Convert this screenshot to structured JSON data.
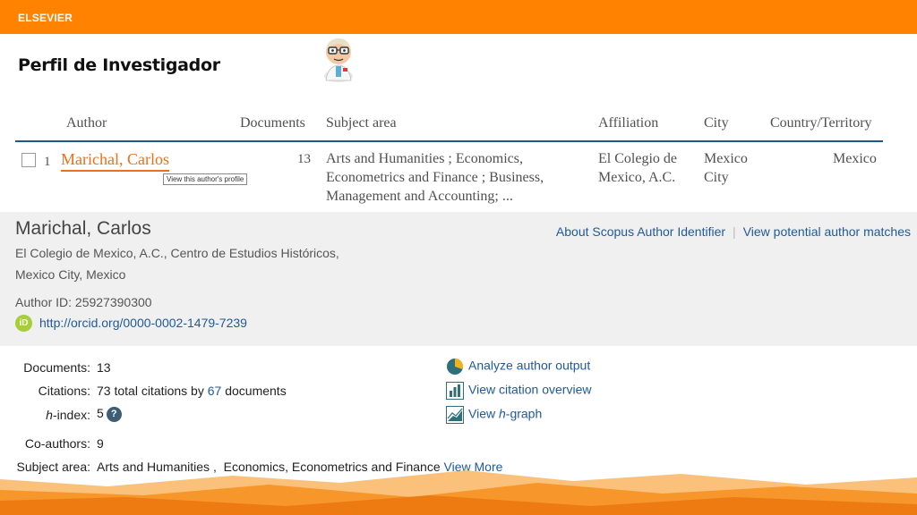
{
  "header": {
    "brand": "ELSEVIER",
    "accent": "#ff8200"
  },
  "page": {
    "title": "Perfil de Investigador",
    "mascot_icon": "scientist-cartoon-icon"
  },
  "results_table": {
    "columns": [
      "Author",
      "Documents",
      "Subject area",
      "Affiliation",
      "City",
      "Country/Territory"
    ],
    "rows": [
      {
        "index": "1",
        "author": "Marichal, Carlos",
        "tooltip": "View this author's profile",
        "documents": "13",
        "subject_lines": [
          "Arts and Humanities ; Economics,",
          "Econometrics and Finance ; Business,",
          "Management and Accounting; ..."
        ],
        "affiliation_lines": [
          "El Colegio de",
          "Mexico, A.C."
        ],
        "city_lines": [
          "Mexico",
          "City"
        ],
        "country": "Mexico"
      }
    ]
  },
  "author_details": {
    "name": "Marichal, Carlos",
    "affiliation_line1": "El Colegio de Mexico, A.C., Centro de Estudios Históricos,",
    "affiliation_line2": "Mexico City, Mexico",
    "author_id": "Author ID: 25927390300",
    "orcid_url": "http://orcid.org/0000-0002-1479-7239",
    "links": [
      "About Scopus Author Identifier",
      "View potential author matches"
    ]
  },
  "metrics": {
    "documents_label": "Documents:",
    "documents_value": "13",
    "citations_label": "Citations:",
    "citations_prefix": "73 total citations by",
    "citations_docs": "67",
    "citations_suffix": "documents",
    "hindex_label_h": "h",
    "hindex_label_rest": "-index:",
    "hindex_value": "5",
    "coauthors_label": "Co-authors:",
    "coauthors_value": "9",
    "subject_label": "Subject area:",
    "subject_value": "Arts and Humanities ,  Economics, Econometrics and Finance",
    "view_more": "View More"
  },
  "actions": {
    "analyze": "Analyze author output",
    "citation_overview": "View citation overview",
    "hgraph_prefix": "View ",
    "hgraph_h": "h",
    "hgraph_suffix": "-graph"
  }
}
